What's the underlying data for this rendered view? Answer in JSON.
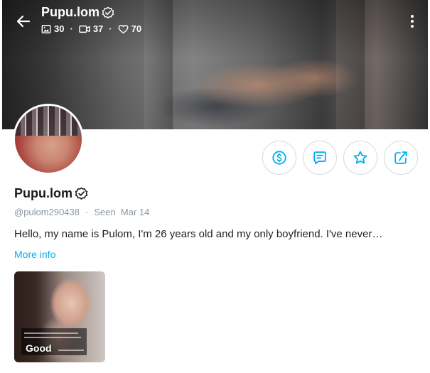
{
  "header": {
    "name": "Pupu.lom",
    "stats": [
      {
        "icon": "image-icon",
        "value": "30"
      },
      {
        "icon": "video-icon",
        "value": "37"
      },
      {
        "icon": "heart-icon",
        "value": "70"
      }
    ]
  },
  "profile": {
    "name": "Pupu.lom",
    "handle": "@pulom290438",
    "separator": "·",
    "seen": "Seen  Mar 14",
    "bio": "Hello, my name is Pulom, I'm 26 years old and my only boyfriend. I've never…",
    "more_info": "More info"
  },
  "actions": [
    {
      "name": "tip-button",
      "icon": "dollar-icon"
    },
    {
      "name": "message-button",
      "icon": "message-icon"
    },
    {
      "name": "favorite-button",
      "icon": "star-icon"
    },
    {
      "name": "share-button",
      "icon": "share-icon"
    }
  ],
  "media": [
    {
      "label": "Good"
    }
  ],
  "colors": {
    "accent": "#00aff0",
    "muted": "#8a96a3",
    "border": "#d8dadd"
  }
}
